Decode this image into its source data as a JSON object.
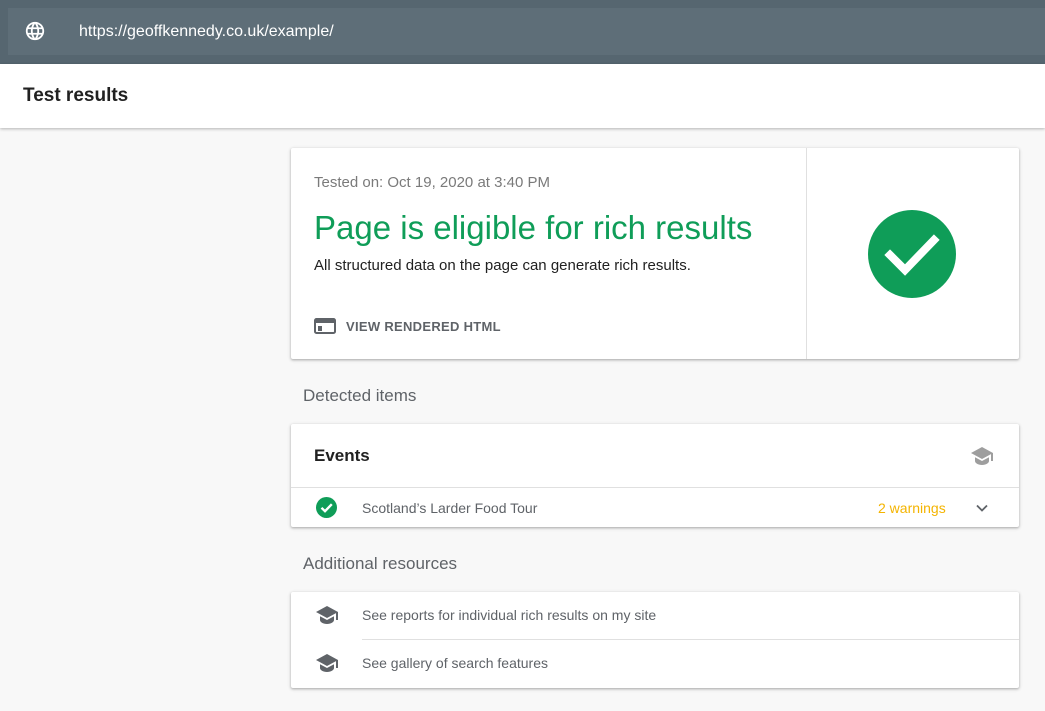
{
  "urlbar": {
    "url": "https://geoffkennedy.co.uk/example/",
    "icon": "globe-icon"
  },
  "header": {
    "title": "Test results"
  },
  "result": {
    "tested_on": "Tested on: Oct 19, 2020 at 3:40 PM",
    "title": "Page is eligible for rich results",
    "description": "All structured data on the page can generate rich results.",
    "view_html_label": "VIEW RENDERED HTML",
    "view_html_icon": "browser-window-icon",
    "status_icon": "check-circle-icon"
  },
  "detected": {
    "section_label": "Detected items",
    "card_title": "Events",
    "card_icon": "graduation-cap-icon",
    "items": [
      {
        "name": "Scotland’s Larder Food Tour",
        "warnings": "2 warnings",
        "status_icon": "check-circle-icon",
        "expand_icon": "chevron-down-icon"
      }
    ]
  },
  "resources": {
    "section_label": "Additional resources",
    "items": [
      {
        "label": "See reports for individual rich results on my site",
        "icon": "graduation-cap-icon"
      },
      {
        "label": "See gallery of search features",
        "icon": "graduation-cap-icon"
      }
    ]
  },
  "colors": {
    "success_green": "#0f9d58",
    "warning_amber": "#f4b400",
    "urlbar_bg": "#566670",
    "text_primary": "#212121",
    "text_secondary": "#5f6368"
  }
}
